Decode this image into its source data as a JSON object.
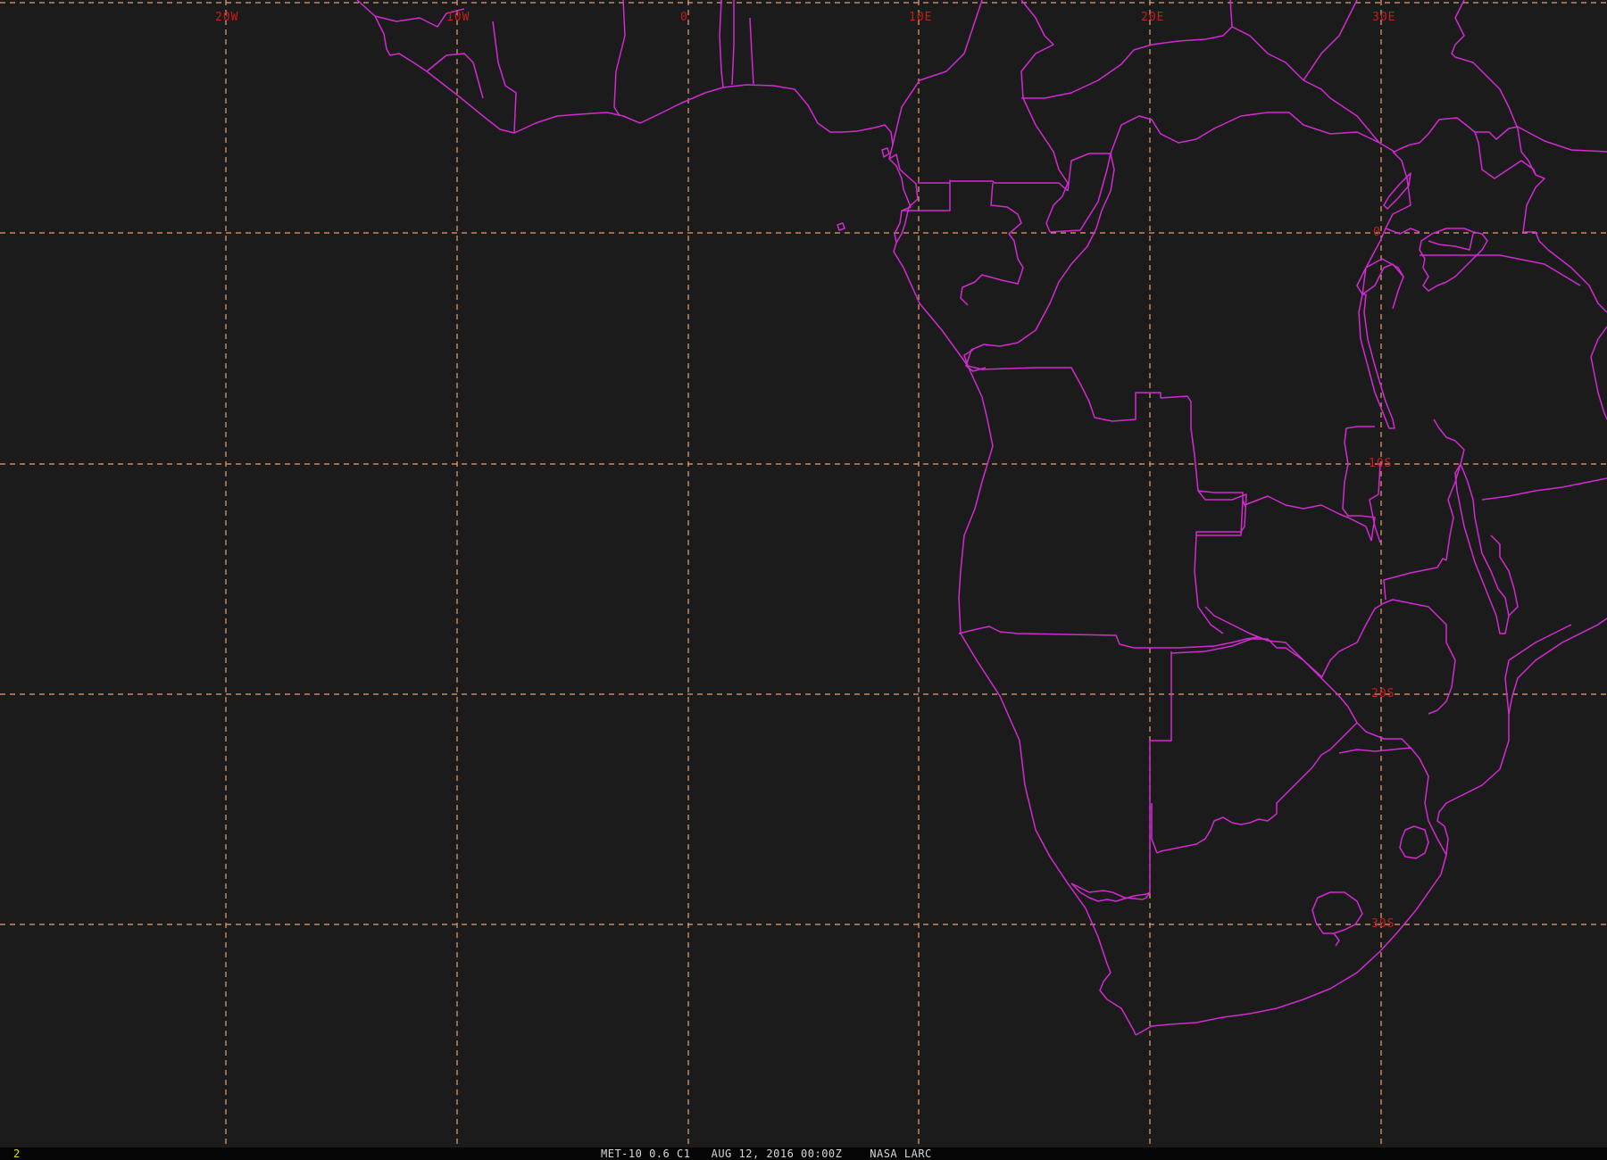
{
  "map": {
    "background_color": "#1b1b1b",
    "graticule_color": "#e8a070",
    "boundary_color": "#d22ad2",
    "label_color": "#c81c1c",
    "longitude_labels": [
      "20W",
      "10W",
      "0",
      "10E",
      "20E",
      "30E"
    ],
    "latitude_labels": [
      "0",
      "10S",
      "20S",
      "30S"
    ]
  },
  "status_bar": {
    "frame_number": "2",
    "caption": "MET-10 0.6 C1   AUG 12, 2016 00:00Z    NASA LARC"
  }
}
